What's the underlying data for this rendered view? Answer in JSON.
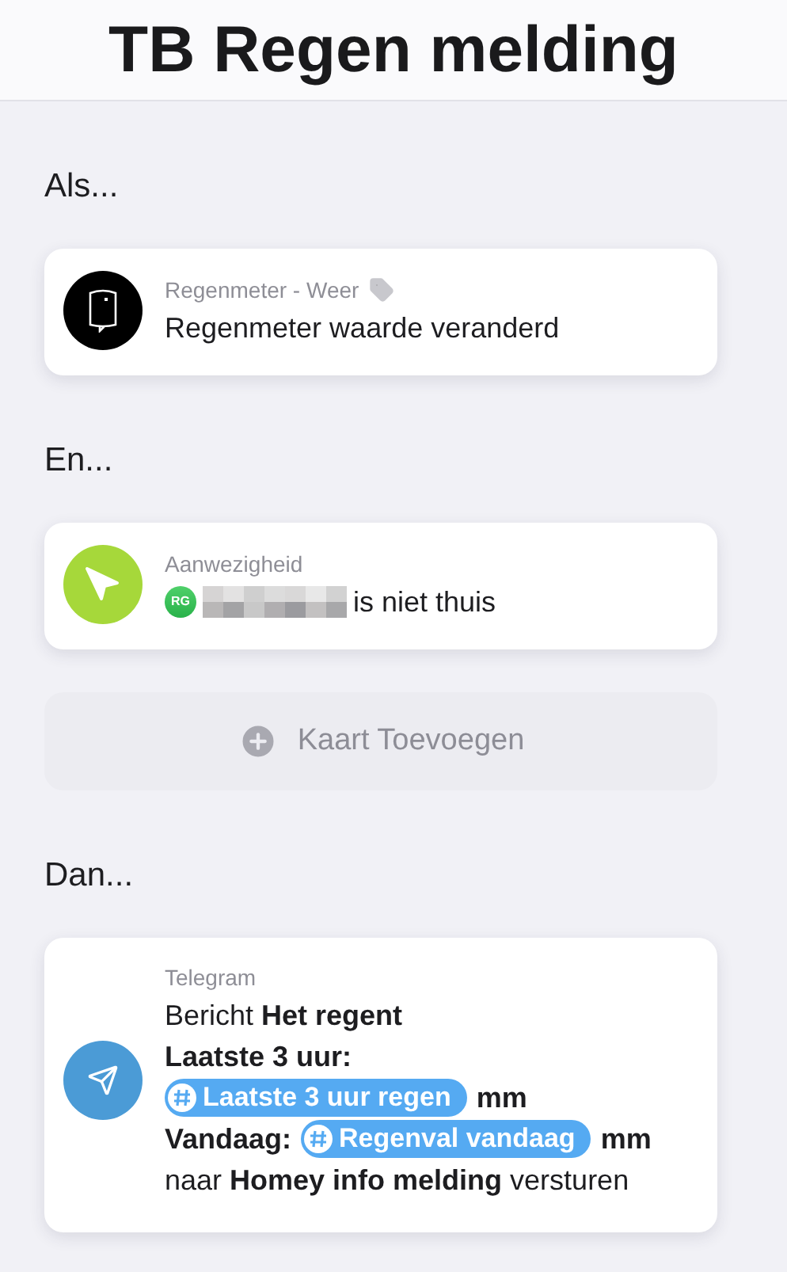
{
  "title": "TB Regen melding",
  "sections": [
    {
      "heading": "Als...",
      "cards": [
        {
          "kind": "trigger",
          "color": "#000000",
          "app": "Regenmeter - Weer",
          "tagged": true,
          "text": "Regenmeter waarde veranderd"
        }
      ]
    },
    {
      "heading": "En...",
      "cards": [
        {
          "kind": "presence",
          "color": "#a6d83a",
          "app": "Aanwezigheid",
          "user_initials": "RG",
          "text": "is niet thuis"
        }
      ],
      "add_card": {
        "label": "Kaart Toevoegen"
      }
    },
    {
      "heading": "Dan...",
      "cards": [
        {
          "kind": "message",
          "color": "#4b9bd6",
          "app": "Telegram",
          "lines": [
            [
              {
                "kind": "text",
                "text": "Bericht **Het regent**",
                "bold": false
              }
            ],
            [
              {
                "kind": "text",
                "text": "Laatste 3 uur:",
                "bold": true
              }
            ],
            [
              {
                "kind": "token",
                "text": "Laatste 3 uur regen"
              },
              {
                "kind": "text",
                "text": "mm",
                "bold": true
              }
            ],
            [
              {
                "kind": "text",
                "text": "Vandaag:",
                "bold": true
              },
              {
                "kind": "token",
                "text": "Regenval vandaag"
              },
              {
                "kind": "text",
                "text": "mm",
                "bold": true
              }
            ],
            [
              {
                "kind": "text",
                "text": "naar **Homey info melding** versturen",
                "bold": false
              }
            ]
          ]
        }
      ]
    }
  ]
}
